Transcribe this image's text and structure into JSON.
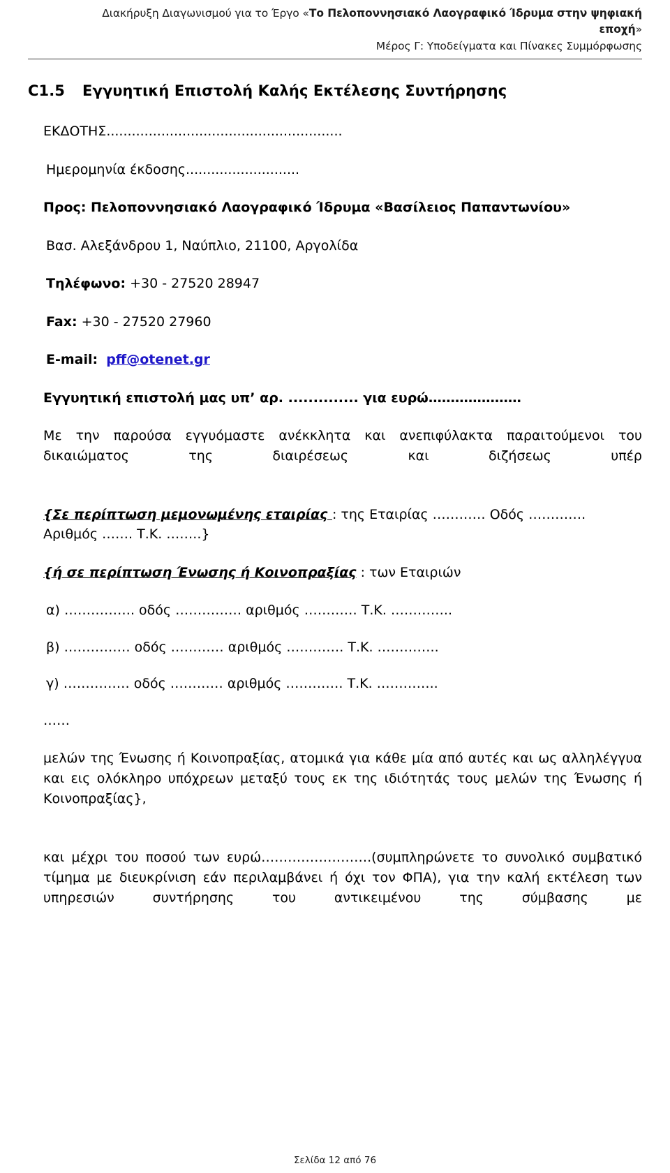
{
  "header": {
    "line1_prefix": "Διακήρυξη Διαγωνισμού για το Έργο «",
    "line1_bold": "Το Πελοποννησιακό Λαογραφικό Ίδρυμα στην ψηφιακή",
    "line2_bold": "εποχή",
    "line2_suffix": "»",
    "line3": "Μέρος Γ: Υποδείγματα και Πίνακες Συμμόρφωσης"
  },
  "section": {
    "number": "C1.5",
    "title": "Εγγυητική Επιστολή Καλής Εκτέλεσης Συντήρησης"
  },
  "issuer": {
    "label_line": "ΕΚΔΟΤΗΣ........................................................",
    "date_line": "Ημερομηνία έκδοσης..........................."
  },
  "recipient": {
    "to_line": "Προς: Πελοποννησιακό Λαογραφικό Ίδρυμα «Βασίλειος Παπαντωνίου»",
    "address": "Βασ. Αλεξάνδρου 1, Ναύπλιο, 21100, Αργολίδα",
    "phone_label": "Τηλέφωνο:",
    "phone_value": " +30 - 27520 28947",
    "fax_label": "Fax:",
    "fax_value": " +30 - 27520 27960",
    "email_label": "E-mail:",
    "email_value": "pff@otenet.gr"
  },
  "letter": {
    "reference_line": "Εγγυητική επιστολή μας υπ’ αρ. .............. για ευρώ…………………",
    "intro_paragraph": "Με την παρούσα εγγυόμαστε ανέκκλητα και ανεπιφύλακτα παραιτούμενοι του δικαιώματος της διαιρέσεως και διζήσεως υπέρ",
    "single_company_italic": "{Σε περίπτωση μεμονωμένης εταιρίας ",
    "single_company_rest": ": της Εταιρίας ………… Οδός …………. Αριθμός ……. Τ.Κ. ……..}",
    "consortium_italic": "{ή σε περίπτωση Ένωσης ή Κοινοπραξίας",
    "consortium_rest": " : των Εταιριών",
    "members": [
      "α) ……………. οδός …………… αριθμός ………… Τ.Κ. …………..",
      "β) …………… οδός ………… αριθμός …………. Τ.Κ. …………..",
      "γ) …………… οδός ………… αριθμός …………. Τ.Κ. ………….."
    ],
    "ellipsis_line": "……",
    "members_paragraph": "μελών της Ένωσης ή Κοινοπραξίας, ατομικά για κάθε μία από αυτές και ως αλληλέγγυα και εις ολόκληρο υπόχρεων μεταξύ τους εκ της ιδιότητάς τους μελών της Ένωσης ή Κοινοπραξίας},",
    "amount_paragraph": "και μέχρι του ποσού των ευρώ…………………….(συμπληρώνετε το συνολικό συμβατικό τίμημα με διευκρίνιση εάν περιλαμβάνει ή όχι τον ΦΠΑ), για την καλή εκτέλεση των υπηρεσιών συντήρησης του αντικειμένου της σύμβασης με"
  },
  "footer": {
    "page_label": "Σελίδα 12 από 76"
  },
  "colors": {
    "link": "#1d16c8",
    "text": "#000000",
    "rule": "#3a3a3a"
  }
}
